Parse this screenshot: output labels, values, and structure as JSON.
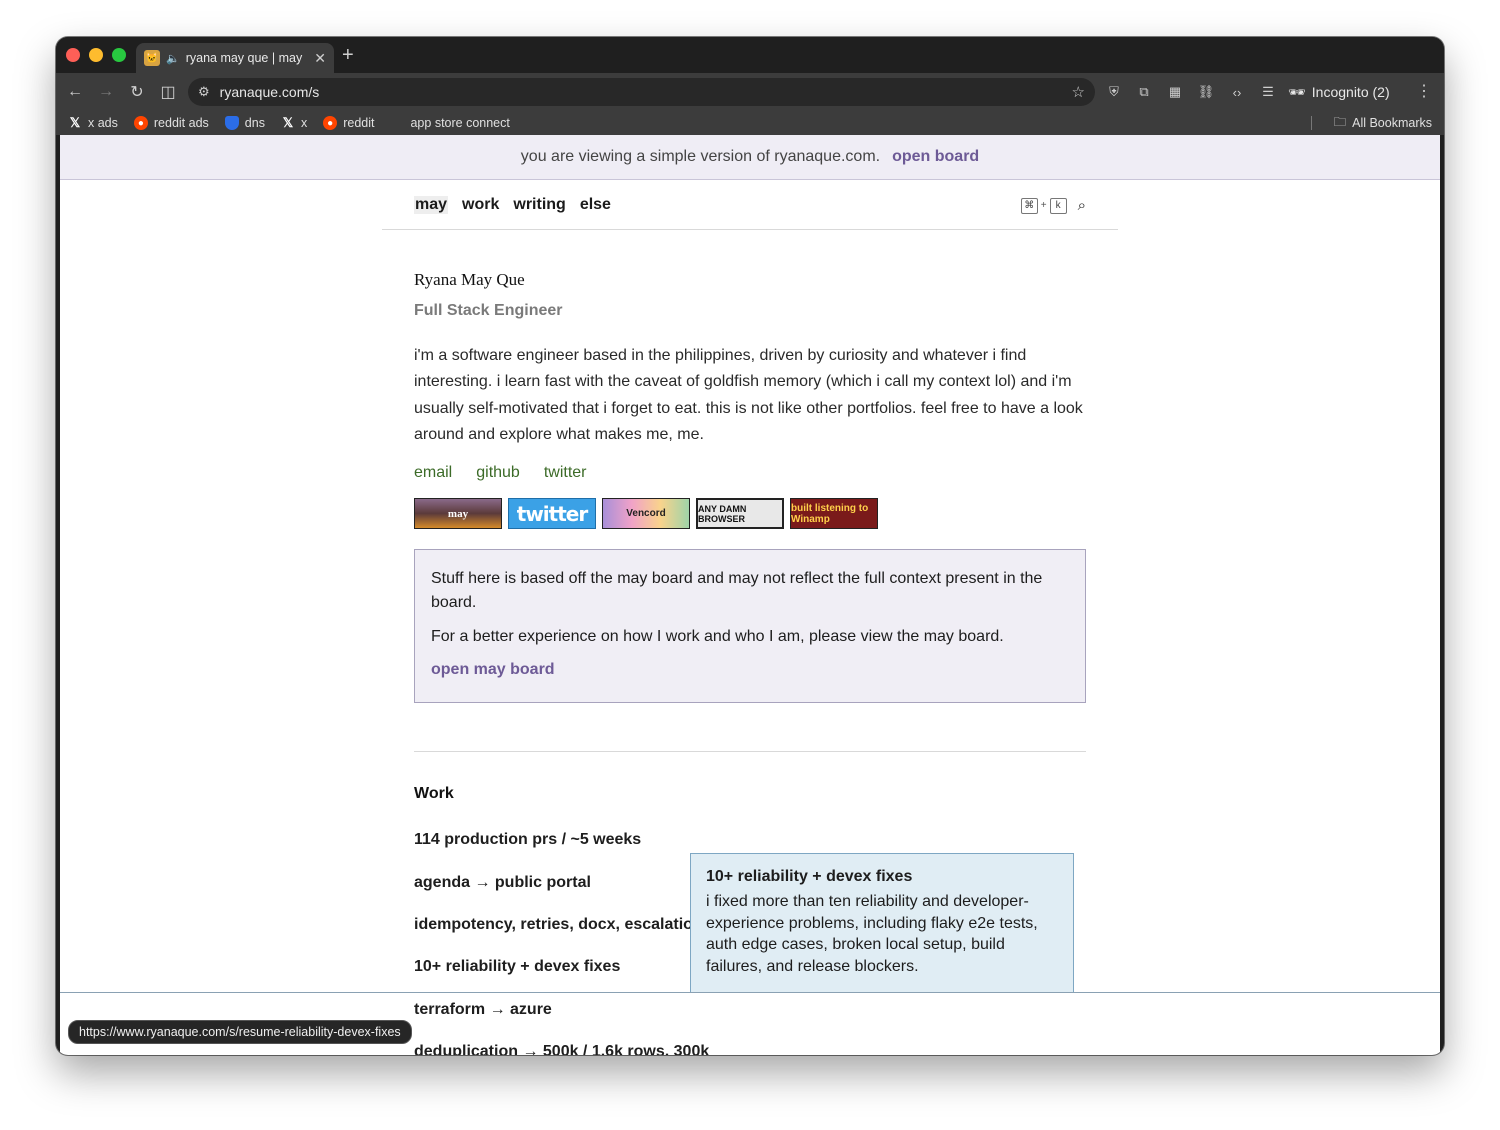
{
  "browser": {
    "tab_title": "ryana may que | may",
    "url": "ryanaque.com/s",
    "incognito_label": "Incognito (2)",
    "bookmarks": [
      {
        "label": "x ads",
        "icon": "x-icon"
      },
      {
        "label": "reddit ads",
        "icon": "reddit-icon"
      },
      {
        "label": "dns",
        "icon": "shield-icon"
      },
      {
        "label": "x",
        "icon": "x-icon"
      },
      {
        "label": "reddit",
        "icon": "reddit-icon"
      },
      {
        "label": "app store connect",
        "icon": "apple-icon"
      }
    ],
    "all_bookmarks": "All Bookmarks",
    "status_url": "https://www.ryanaque.com/s/resume-reliability-devex-fixes"
  },
  "banner": {
    "text": "you are viewing a simple version of ryanaque.com.",
    "link": "open board"
  },
  "nav": {
    "items": [
      "may",
      "work",
      "writing",
      "else"
    ],
    "active": "may",
    "kbd_cmd": "⌘",
    "kbd_plus": "+",
    "kbd_key": "k"
  },
  "profile": {
    "name": "Ryana May Que",
    "role": "Full Stack Engineer",
    "bio": "i'm a software engineer based in the philippines, driven by curiosity and whatever i find interesting. i learn fast with the caveat of goldfish memory (which i call my context lol) and i'm usually self-motivated that i forget to eat. this is not like other portfolios. feel free to have a look around and explore what makes me, me.",
    "links": [
      "email",
      "github",
      "twitter"
    ],
    "badges": [
      {
        "label": "may"
      },
      {
        "label": "twitter"
      },
      {
        "label": "Vencord"
      },
      {
        "label": "ANY DAMN BROWSER"
      },
      {
        "label": "built listening to Winamp"
      }
    ]
  },
  "notice": {
    "line1": "Stuff here is based off the may board and may not reflect the full context present in the board.",
    "line2": "For a better experience on how I work and who I am, please view the may board.",
    "link": "open may board"
  },
  "work": {
    "heading": "Work",
    "items": [
      "114 production prs / ~5 weeks",
      "agenda → public portal",
      "idempotency, retries, docx, escalation",
      "10+ reliability + devex fixes",
      "terraform → azure",
      "deduplication → 500k / 1.6k rows, 300k"
    ]
  },
  "tooltip": {
    "title": "10+ reliability + devex fixes",
    "body": "i fixed more than ten reliability and developer-experience problems, including flaky e2e tests, auth edge cases, broken local setup, build failures, and release blockers."
  }
}
